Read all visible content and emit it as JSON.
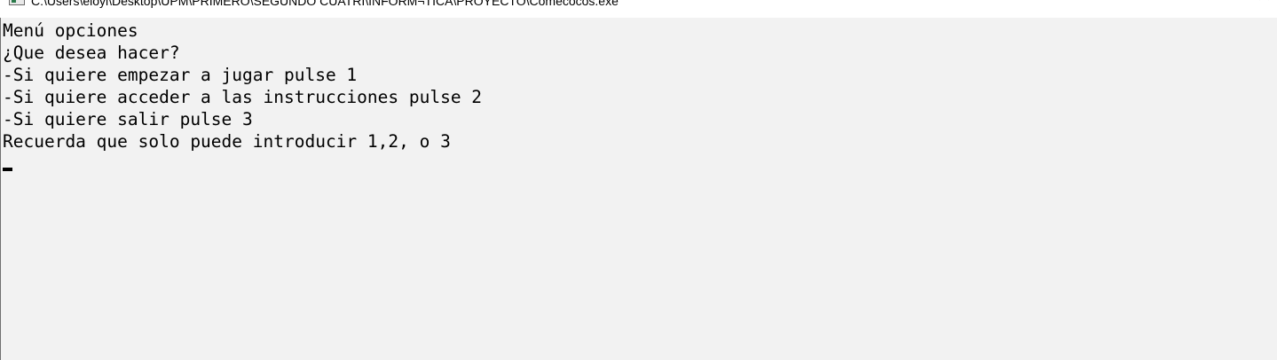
{
  "window": {
    "title": "C:\\Users\\eloyl\\Desktop\\UPM\\PRIMERO\\SEGUNDO CUATRI\\INFORM¬TICA\\PROYECTO\\Comecocos.exe",
    "icon": "console-app-icon",
    "controls": {
      "minimize": "minimize-icon",
      "maximize": "maximize-icon",
      "close": "close-icon"
    }
  },
  "console": {
    "background": "#f2f2f2",
    "text_color": "#000000",
    "lines": [
      "Menú opciones",
      "¿Que desea hacer?",
      "-Si quiere empezar a jugar pulse 1",
      "-Si quiere acceder a las instrucciones pulse 2",
      "-Si quiere salir pulse 3",
      "Recuerda que solo puede introducir 1,2, o 3"
    ]
  }
}
